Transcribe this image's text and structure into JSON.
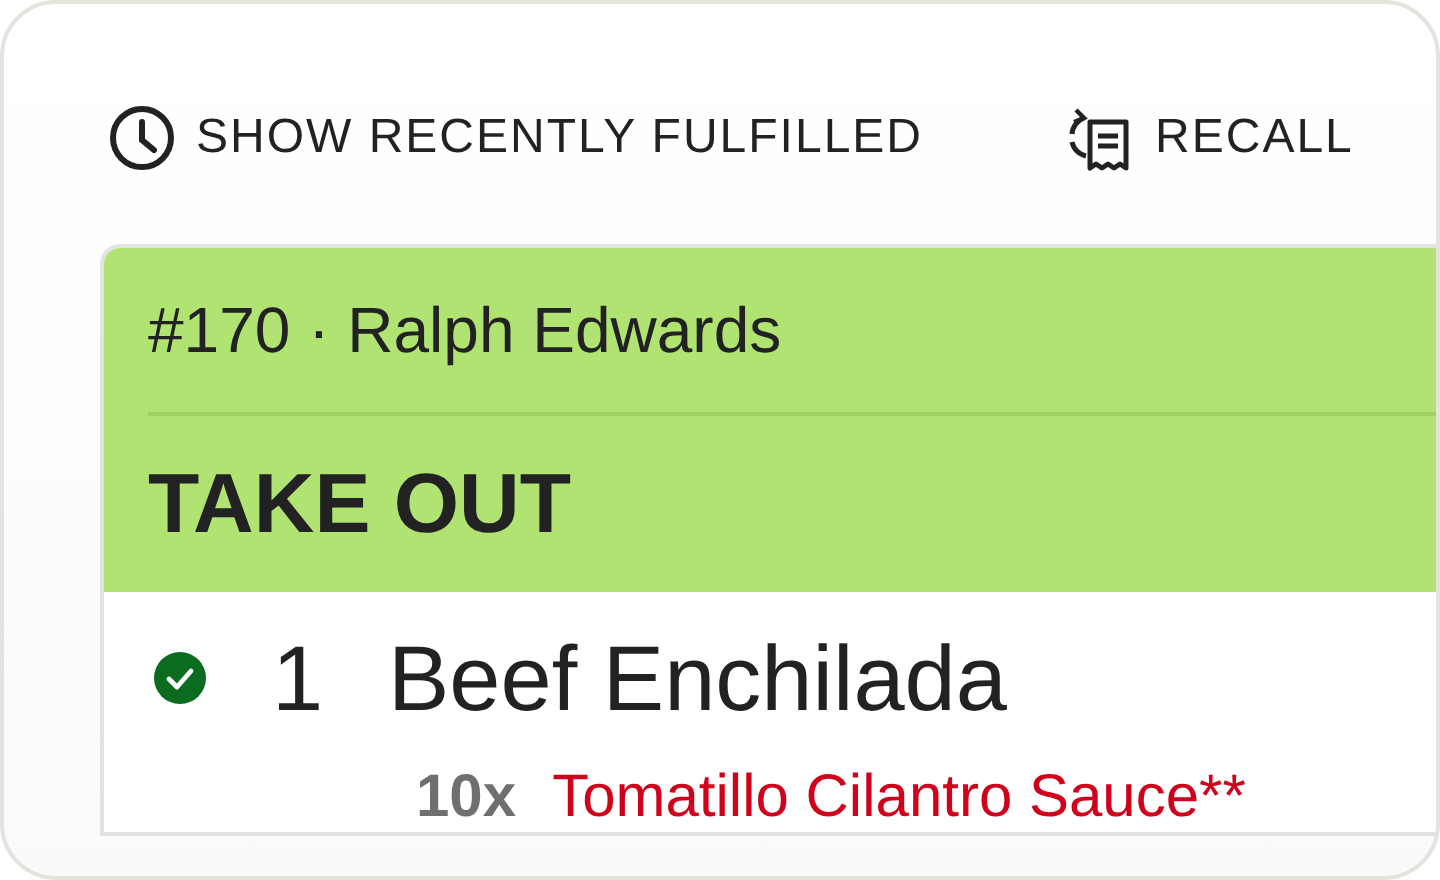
{
  "toolbar": {
    "buttons": [
      {
        "kind": "clock",
        "label": "SHOW RECENTLY FULFILLED"
      },
      {
        "kind": "recall",
        "label": "RECALL"
      }
    ]
  },
  "order": {
    "number": "#170",
    "separator": "·",
    "customer": "Ralph Edwards",
    "service": "TAKE OUT",
    "items": [
      {
        "done": true,
        "quantity": "1",
        "name": "Beef Enchilada",
        "modifiers": [
          {
            "quantity": "10x",
            "name": "Tomatillo Cilantro Sauce**"
          }
        ]
      }
    ]
  }
}
